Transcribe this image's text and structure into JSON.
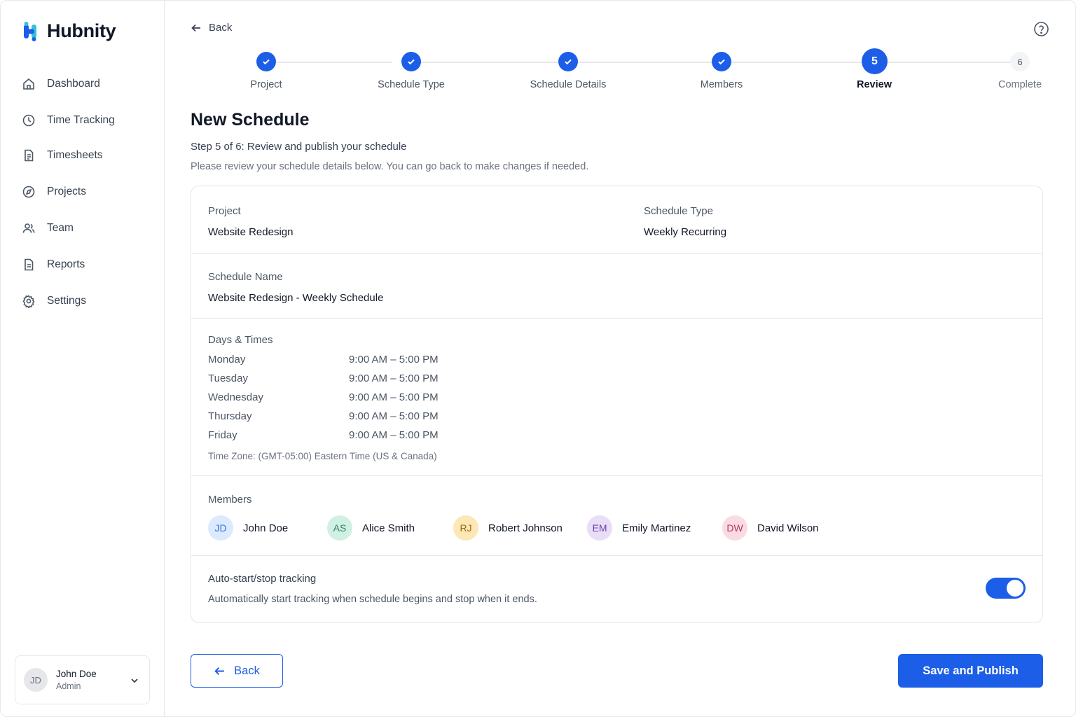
{
  "app": {
    "name": "Hubnity"
  },
  "sidebar": {
    "items": [
      {
        "label": "Dashboard",
        "icon": "home-icon"
      },
      {
        "label": "Time Tracking",
        "icon": "clock-icon"
      },
      {
        "label": "Timesheets",
        "icon": "document-icon"
      },
      {
        "label": "Projects",
        "icon": "compass-icon"
      },
      {
        "label": "Team",
        "icon": "users-icon"
      },
      {
        "label": "Reports",
        "icon": "report-icon"
      },
      {
        "label": "Settings",
        "icon": "gear-icon"
      }
    ],
    "user": {
      "initials": "JD",
      "name": "John Doe",
      "role": "Admin"
    }
  },
  "header": {
    "back_label": "Back"
  },
  "stepper": {
    "steps": [
      {
        "label": "Project",
        "status": "done"
      },
      {
        "label": "Schedule Type",
        "status": "done"
      },
      {
        "label": "Schedule Details",
        "status": "done"
      },
      {
        "label": "Members",
        "status": "done"
      },
      {
        "label": "Review",
        "status": "active",
        "number": "5"
      },
      {
        "label": "Complete",
        "status": "pending",
        "number": "6"
      }
    ]
  },
  "page": {
    "title": "New Schedule",
    "step_subtitle": "Step 5 of 6: Review and publish your schedule",
    "description": "Please review your schedule details below. You can go back to make changes if needed."
  },
  "review": {
    "project_label": "Project",
    "project_value": "Website Redesign",
    "schedule_type_label": "Schedule Type",
    "schedule_type_value": "Weekly Recurring",
    "schedule_name_label": "Schedule Name",
    "schedule_name_value": "Website Redesign - Weekly Schedule",
    "days_label": "Days & Times",
    "days": [
      {
        "day": "Monday",
        "time": "9:00 AM – 5:00 PM"
      },
      {
        "day": "Tuesday",
        "time": "9:00 AM – 5:00 PM"
      },
      {
        "day": "Wednesday",
        "time": "9:00 AM – 5:00 PM"
      },
      {
        "day": "Thursday",
        "time": "9:00 AM – 5:00 PM"
      },
      {
        "day": "Friday",
        "time": "9:00 AM – 5:00 PM"
      }
    ],
    "time_zone": "Time Zone: (GMT-05:00) Eastern Time (US & Canada)",
    "members_label": "Members",
    "members": [
      {
        "initials": "JD",
        "name": "John Doe",
        "bg": "#dbeafe",
        "fg": "#3b6fd8"
      },
      {
        "initials": "AS",
        "name": "Alice Smith",
        "bg": "#d1f0e4",
        "fg": "#2f7d5f"
      },
      {
        "initials": "RJ",
        "name": "Robert Johnson",
        "bg": "#fde7b6",
        "fg": "#9a6a12"
      },
      {
        "initials": "EM",
        "name": "Emily Martinez",
        "bg": "#e9ddf7",
        "fg": "#6d44a8"
      },
      {
        "initials": "DW",
        "name": "David Wilson",
        "bg": "#fbdbe3",
        "fg": "#b13b5b"
      }
    ],
    "auto_title": "Auto-start/stop tracking",
    "auto_desc": "Automatically start tracking when schedule begins and stop when it ends.",
    "auto_enabled": true
  },
  "footer": {
    "back_label": "Back",
    "publish_label": "Save and Publish"
  },
  "colors": {
    "accent": "#1d5ee8",
    "border": "#e5e7eb"
  }
}
